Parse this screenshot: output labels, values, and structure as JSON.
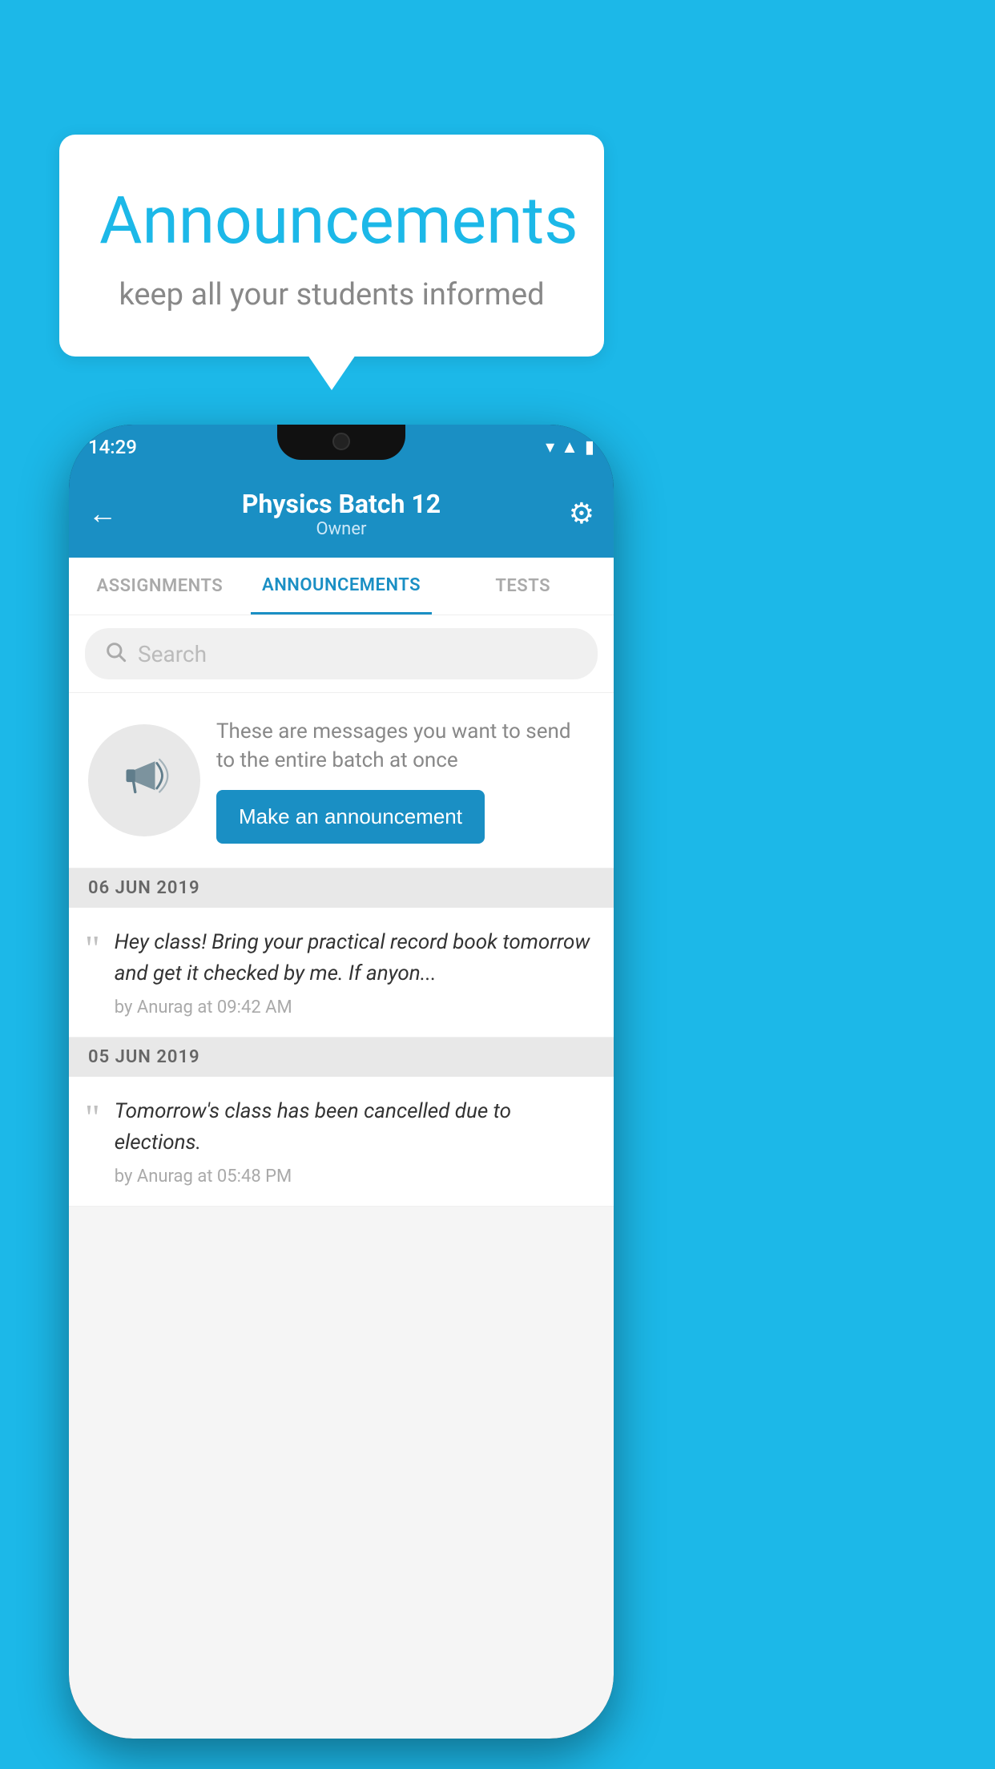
{
  "background_color": "#1cb8e8",
  "speech_bubble": {
    "title": "Announcements",
    "subtitle": "keep all your students informed"
  },
  "phone": {
    "status_bar": {
      "time": "14:29",
      "icons": [
        "wifi",
        "signal",
        "battery"
      ]
    },
    "header": {
      "title": "Physics Batch 12",
      "subtitle": "Owner",
      "back_label": "←",
      "settings_label": "⚙"
    },
    "tabs": [
      {
        "label": "ASSIGNMENTS",
        "active": false
      },
      {
        "label": "ANNOUNCEMENTS",
        "active": true
      },
      {
        "label": "TESTS",
        "active": false
      },
      {
        "label": "...",
        "active": false
      }
    ],
    "search": {
      "placeholder": "Search"
    },
    "promo_card": {
      "description": "These are messages you want to send to the entire batch at once",
      "button_label": "Make an announcement"
    },
    "announcements": [
      {
        "date": "06  JUN  2019",
        "items": [
          {
            "text": "Hey class! Bring your practical record book tomorrow and get it checked by me. If anyon...",
            "meta": "by Anurag at 09:42 AM"
          }
        ]
      },
      {
        "date": "05  JUN  2019",
        "items": [
          {
            "text": "Tomorrow's class has been cancelled due to elections.",
            "meta": "by Anurag at 05:48 PM"
          }
        ]
      }
    ]
  }
}
